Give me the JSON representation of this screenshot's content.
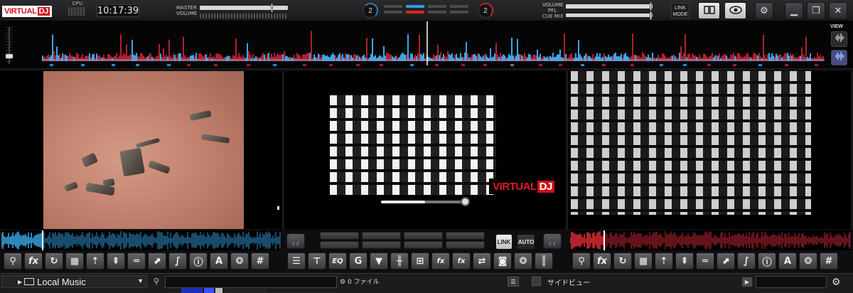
{
  "app": {
    "logo_part1": "VIRTUAL",
    "logo_part2": "DJ",
    "cpu_label": "CPU",
    "clock": "10:17:39",
    "master_volume_label": "MASTER\nVOLUME",
    "master_label_a": "MASTER",
    "master_label_b": "VOLUME",
    "deck_left_number": "2",
    "deck_right_number": "2",
    "volume_label": "VOLUME",
    "pfl_label": "PFL",
    "cuemix_label": "CUE MIX",
    "link_mode_a": "LINK",
    "link_mode_b": "MODE",
    "accent_blue": "#2b9de0",
    "accent_red": "#d0101a",
    "top_buttons": [
      "layout-icon",
      "eye-icon",
      "gear-icon",
      "minimize-icon",
      "restore-icon",
      "close-icon"
    ]
  },
  "overview": {
    "view_label": "VIEW"
  },
  "watermark": {
    "part1": "VIRTUAL",
    "part2": "DJ"
  },
  "center_controls": {
    "link_label": "LINK",
    "auto_label": "AUTO"
  },
  "left_deck_buttons": [
    "pin-icon",
    "fx",
    "loop-icon",
    "grid-icon",
    "up-arrow-icon",
    "sampler-icon",
    "equals-icon",
    "flip-icon",
    "curve-icon",
    "info-icon",
    "A",
    "film-icon",
    "#"
  ],
  "center_buttons": [
    "list-icon",
    "T-icon",
    "EQ",
    "G",
    "filter-icon",
    "split-icon",
    "mixer-icon",
    "fx-pair-icon",
    "fx-one-icon",
    "swap-icon",
    "speaker-icon",
    "film-icon",
    "wave-icon"
  ],
  "right_deck_buttons": [
    "pin-icon",
    "fx",
    "loop-icon",
    "grid-icon",
    "up-arrow-icon",
    "sampler-icon",
    "equals-icon",
    "flip-icon",
    "curve-icon",
    "info-icon",
    "A",
    "film-icon",
    "#"
  ],
  "browser": {
    "folder": "Local Music",
    "search_value": "",
    "file_count": "0 ファイル",
    "sideview_label": "サイドビュー",
    "sideview_search_value": ""
  }
}
